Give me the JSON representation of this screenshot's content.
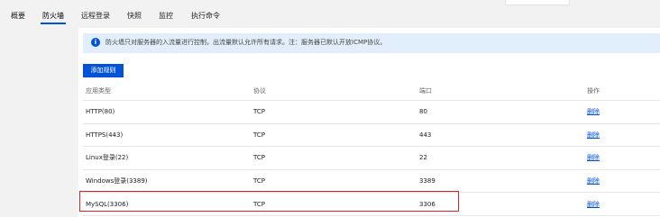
{
  "tabs": [
    {
      "label": "概要"
    },
    {
      "label": "防火墙"
    },
    {
      "label": "远程登录"
    },
    {
      "label": "快照"
    },
    {
      "label": "监控"
    },
    {
      "label": "执行命令"
    }
  ],
  "notice": {
    "text": "防火墙只对服务器的入流量进行控制，出流量默认允许所有请求。注：服务器已默认开放ICMP协议。"
  },
  "add_button_label": "添加规则",
  "table": {
    "headers": [
      "应用类型",
      "协议",
      "端口",
      "操作"
    ],
    "rows": [
      {
        "app": "HTTP(80)",
        "protocol": "TCP",
        "port": "80",
        "action": "删除"
      },
      {
        "app": "HTTPS(443)",
        "protocol": "TCP",
        "port": "443",
        "action": "删除"
      },
      {
        "app": "Linux登录(22)",
        "protocol": "TCP",
        "port": "22",
        "action": "删除"
      },
      {
        "app": "Windows登录(3389)",
        "protocol": "TCP",
        "port": "3389",
        "action": "删除"
      },
      {
        "app": "MySQL(3306)",
        "protocol": "TCP",
        "port": "3306",
        "action": "删除"
      }
    ]
  },
  "colors": {
    "accent": "#0052d9",
    "highlight": "#e02020",
    "notice_bg": "#e3eefd"
  }
}
